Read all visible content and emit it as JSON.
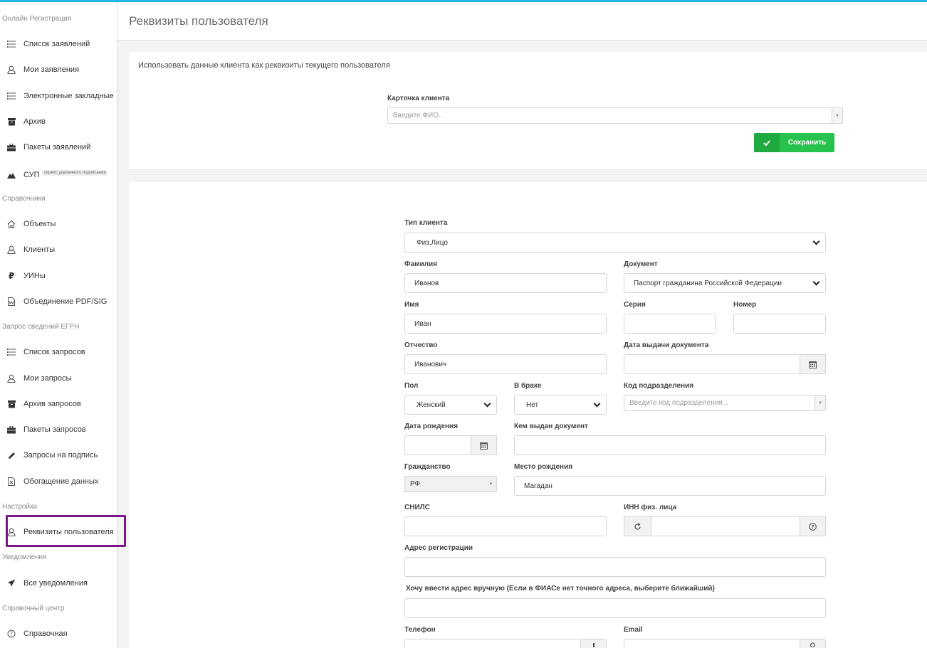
{
  "header": {
    "title": "Реквизиты пользователя"
  },
  "sidebar": {
    "sections": [
      {
        "title": "Онлайн Регистрация",
        "top": 0
      },
      {
        "title": "Справочники"
      },
      {
        "title": "Запрос сведений ЕГРН"
      },
      {
        "title": "Настройки"
      },
      {
        "title": "Уведомления"
      },
      {
        "title": "Справочный центр"
      }
    ],
    "items": [
      {
        "label": "Список заявлений",
        "icon": "list-icon"
      },
      {
        "label": "Мои заявления",
        "icon": "user-icon"
      },
      {
        "label": "Электронные закладные",
        "icon": "list-icon"
      },
      {
        "label": "Архив",
        "icon": "archive-icon"
      },
      {
        "label": "Пакеты заявлений",
        "icon": "briefcase-icon"
      },
      {
        "label": "СУП",
        "icon": "mountain-icon",
        "badge": "сервис удаленного подписания"
      },
      {
        "label": "Объекты",
        "icon": "home-icon"
      },
      {
        "label": "Клиенты",
        "icon": "user-icon"
      },
      {
        "label": "УИНы",
        "icon": "ruble-icon"
      },
      {
        "label": "Объединение PDF/SIG",
        "icon": "word-file-icon"
      },
      {
        "label": "Список запросов",
        "icon": "list-icon"
      },
      {
        "label": "Мои запросы",
        "icon": "user-icon"
      },
      {
        "label": "Архив запросов",
        "icon": "archive-icon"
      },
      {
        "label": "Пакеты запросов",
        "icon": "briefcase-icon"
      },
      {
        "label": "Запросы на подпись",
        "icon": "pencil-icon"
      },
      {
        "label": "Обогащение данных",
        "icon": "excel-file-icon"
      },
      {
        "label": "Реквизиты пользователя",
        "icon": "user-icon",
        "active": true
      },
      {
        "label": "Все уведомления",
        "icon": "paper-plane-icon"
      },
      {
        "label": "Справочная",
        "icon": "question-circle-icon"
      }
    ]
  },
  "client_card": {
    "description": "Использовать данные клиента как реквизиты текущего пользователя",
    "label": "Карточка клиента",
    "placeholder": "Введите ФИО...",
    "save_label": "Сохранить"
  },
  "form": {
    "client_type": {
      "label": "Тип клиента",
      "value": "Физ.Лицо"
    },
    "last_name": {
      "label": "Фамилия",
      "value": "Иванов"
    },
    "document": {
      "label": "Документ",
      "value": "Паспорт гражданина Российской Федерации"
    },
    "first_name": {
      "label": "Имя",
      "value": "Иван"
    },
    "series": {
      "label": "Серия",
      "value": ""
    },
    "number": {
      "label": "Номер",
      "value": ""
    },
    "patronymic": {
      "label": "Отчество",
      "value": "Иванович"
    },
    "issue_date": {
      "label": "Дата выдачи документа",
      "value": ""
    },
    "gender": {
      "label": "Пол",
      "value": "Женский"
    },
    "married": {
      "label": "В браке",
      "value": "Нет"
    },
    "division_code": {
      "label": "Код подразделения",
      "placeholder": "Введите код подразделения..."
    },
    "birth_date": {
      "label": "Дата рождения",
      "value": ""
    },
    "issued_by": {
      "label": "Кем выдан документ",
      "value": ""
    },
    "citizenship": {
      "label": "Гражданство",
      "value": "РФ"
    },
    "birth_place": {
      "label": "Место рождения",
      "value": "Магадан"
    },
    "snils": {
      "label": "СНИЛС",
      "value": ""
    },
    "inn": {
      "label": "ИНН физ. лица",
      "value": ""
    },
    "reg_address": {
      "label": "Адрес регистрации",
      "value": ""
    },
    "manual_address": {
      "label": "Хочу ввести адрес вручную (Если в ФИАСе нет точного адреса, выберите ближайший)",
      "value": ""
    },
    "phone": {
      "label": "Телефон",
      "value": ""
    },
    "email": {
      "label": "Email",
      "value": ""
    }
  }
}
